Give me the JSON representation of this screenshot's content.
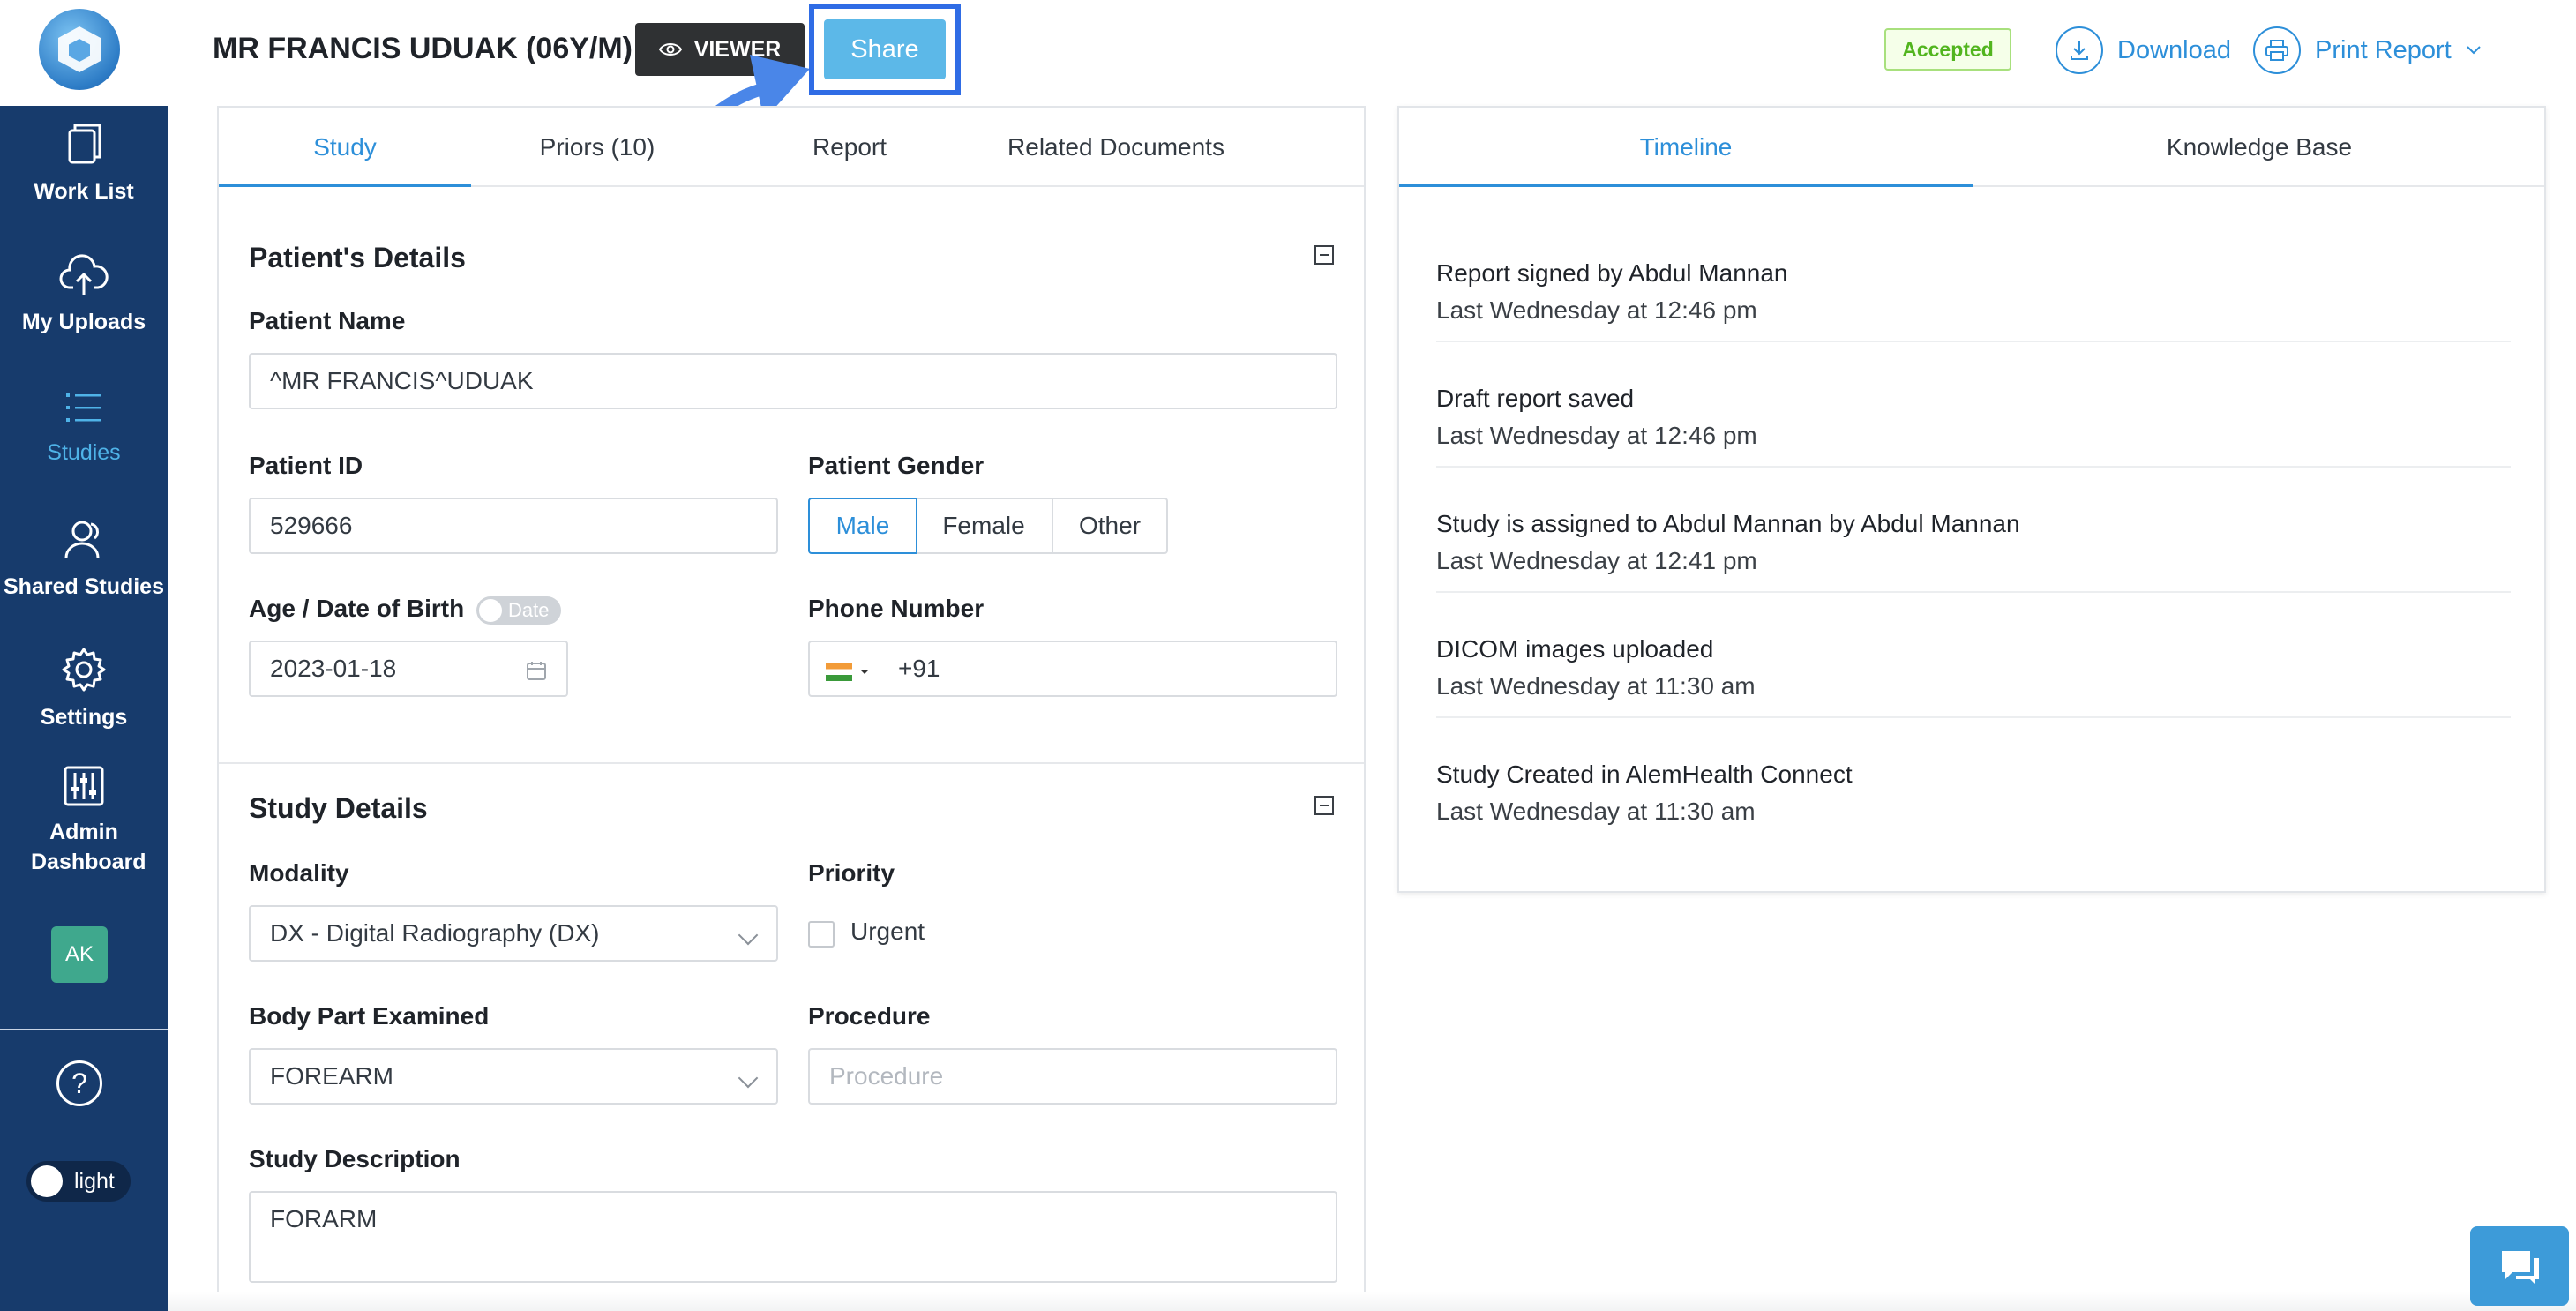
{
  "sidebar": {
    "items": [
      {
        "label": "Work List",
        "icon": "worklist-icon"
      },
      {
        "label": "My Uploads",
        "icon": "upload-cloud-icon"
      },
      {
        "label": "Studies",
        "icon": "list-icon"
      },
      {
        "label": "Shared Studies",
        "icon": "shared-users-icon"
      },
      {
        "label": "Settings",
        "icon": "gear-icon"
      },
      {
        "label": "Admin Dashboard",
        "icon": "sliders-icon"
      }
    ],
    "active_item": "Studies",
    "avatar_initials": "AK",
    "help_icon": "question-circle-icon",
    "theme_label": "light"
  },
  "header": {
    "patient_title": "MR FRANCIS UDUAK (06Y/M)",
    "viewer_label": "VIEWER",
    "share_label": "Share",
    "status_badge": "Accepted",
    "download_label": "Download",
    "print_label": "Print Report"
  },
  "left_tabs": [
    "Study",
    "Priors (10)",
    "Report",
    "Related Documents"
  ],
  "patient_details": {
    "title": "Patient's Details",
    "patient_name_label": "Patient Name",
    "patient_name": "^MR FRANCIS^UDUAK",
    "patient_id_label": "Patient ID",
    "patient_id": "529666",
    "gender_label": "Patient Gender",
    "gender_options": [
      "Male",
      "Female",
      "Other"
    ],
    "gender_selected": "Male",
    "age_label": "Age / Date of Birth",
    "date_toggle_label": "Date",
    "dob": "2023-01-18",
    "phone_label": "Phone Number",
    "phone_value": "+91"
  },
  "study_details": {
    "title": "Study Details",
    "modality_label": "Modality",
    "modality_value": "DX - Digital Radiography (DX)",
    "priority_label": "Priority",
    "urgent_label": "Urgent",
    "body_part_label": "Body Part Examined",
    "body_part_value": "FOREARM",
    "procedure_label": "Procedure",
    "procedure_placeholder": "Procedure",
    "description_label": "Study Description",
    "description_value": "FORARM"
  },
  "right_tabs": [
    "Timeline",
    "Knowledge Base"
  ],
  "timeline": [
    {
      "event": "Report signed by Abdul Mannan",
      "time": "Last Wednesday at 12:46 pm"
    },
    {
      "event": "Draft report saved",
      "time": "Last Wednesday at 12:46 pm"
    },
    {
      "event": "Study is assigned to Abdul Mannan by Abdul Mannan",
      "time": "Last Wednesday at 12:41 pm"
    },
    {
      "event": "DICOM images uploaded",
      "time": "Last Wednesday at 11:30 am"
    },
    {
      "event": "Study Created in AlemHealth Connect",
      "time": "Last Wednesday at 11:30 am"
    }
  ],
  "colors": {
    "sidebar": "#173b6c",
    "accent": "#2d8fd9",
    "accepted": "#52b51f",
    "highlight": "#2f6ce5"
  }
}
